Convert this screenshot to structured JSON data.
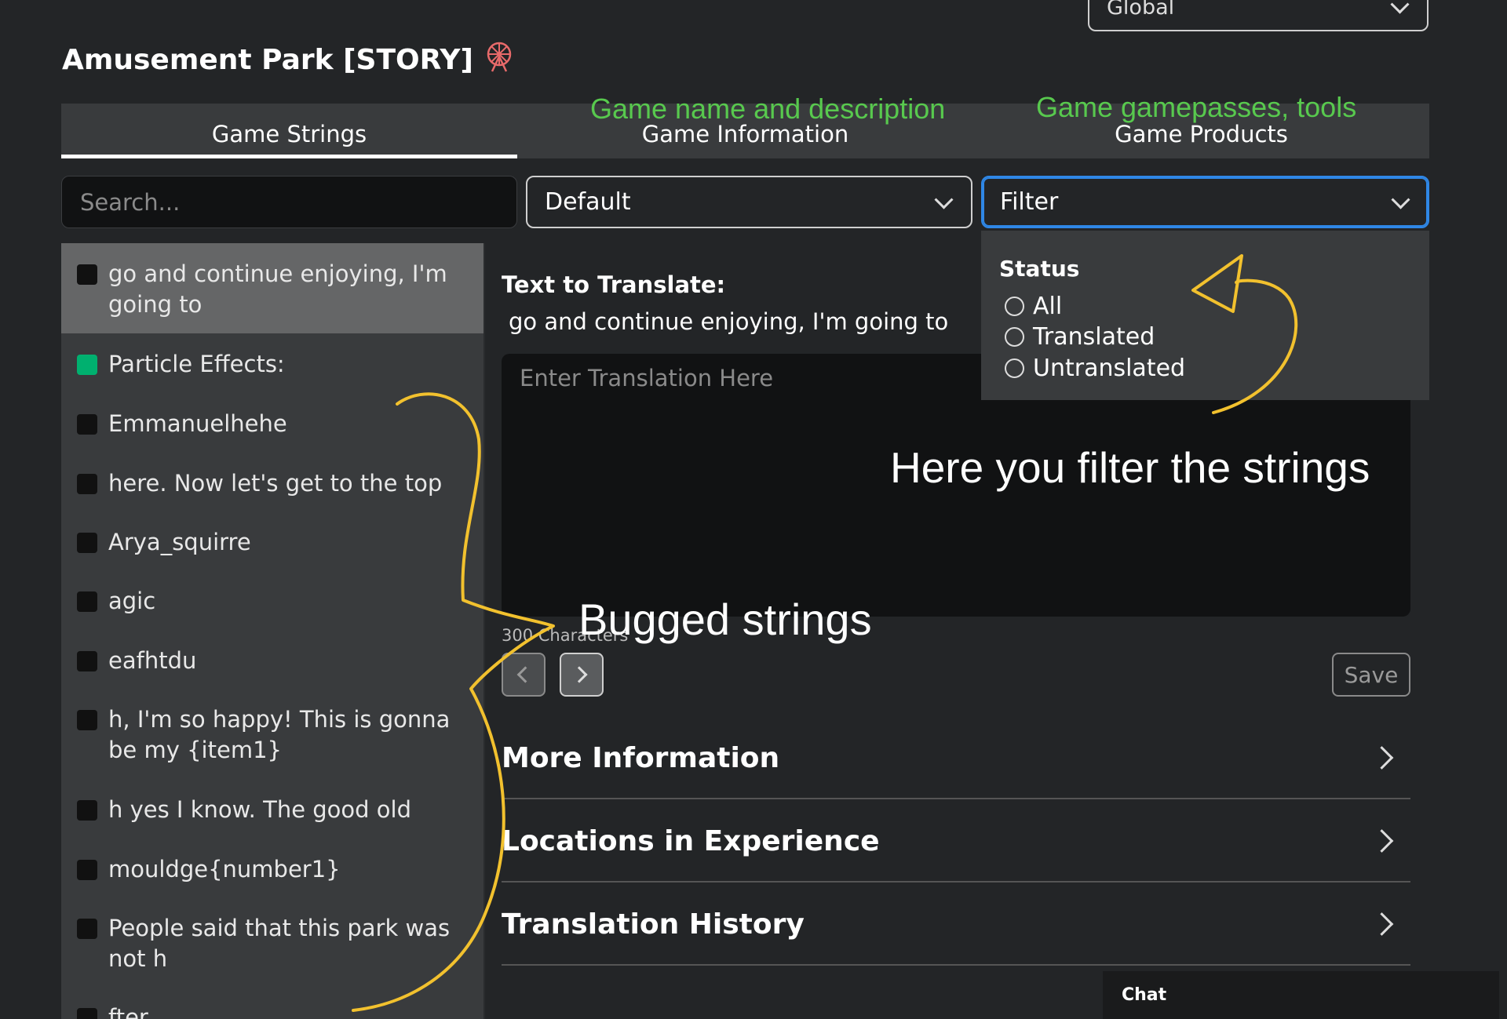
{
  "header": {
    "language_select": "Global",
    "game_title": "Amusement Park [STORY]",
    "title_icon": "ferris-wheel-icon"
  },
  "tabs": [
    {
      "label": "Game Strings",
      "active": true
    },
    {
      "label": "Game Information",
      "active": false
    },
    {
      "label": "Game Products",
      "active": false
    }
  ],
  "controls": {
    "search_placeholder": "Search...",
    "sort_select": "Default",
    "filter_select": "Filter"
  },
  "filter_popup": {
    "status_label": "Status",
    "options": [
      "All",
      "Translated",
      "Untranslated"
    ]
  },
  "strings_list": [
    {
      "text": "go and continue enjoying, I'm going to",
      "translated": false,
      "selected": true
    },
    {
      "text": "Particle Effects:",
      "translated": true,
      "selected": false
    },
    {
      "text": "Emmanuelhehe",
      "translated": false,
      "selected": false
    },
    {
      "text": "here. Now let's get to the top",
      "translated": false,
      "selected": false
    },
    {
      "text": "Arya_squirre",
      "translated": false,
      "selected": false
    },
    {
      "text": "agic",
      "translated": false,
      "selected": false
    },
    {
      "text": "eafhtdu",
      "translated": false,
      "selected": false
    },
    {
      "text": "h, I'm so happy! This is gonna be my {item1}",
      "translated": false,
      "selected": false
    },
    {
      "text": "h yes I know. The good old",
      "translated": false,
      "selected": false
    },
    {
      "text": "mouldge{number1}",
      "translated": false,
      "selected": false
    },
    {
      "text": "People said that this park was not h",
      "translated": false,
      "selected": false
    },
    {
      "text": "fter",
      "translated": false,
      "selected": false
    }
  ],
  "editor": {
    "text_to_translate_label": "Text to Translate:",
    "source_text": "go and continue enjoying, I'm going to",
    "translation_placeholder": "Enter Translation Here",
    "char_limit": "300 Characters",
    "save_label": "Save"
  },
  "sections": [
    "More Information",
    "Locations in Experience",
    "Translation History"
  ],
  "chat_label": "Chat",
  "annotations": {
    "game_info_note": "Game name and description",
    "game_products_note": "Game gamepasses, tools",
    "filter_note": "Here you filter the strings",
    "bugged_note": "Bugged strings"
  },
  "colors": {
    "background": "#232527",
    "panel": "#393b3d",
    "translated_green": "#00b06f",
    "filter_focus": "#2f87e6",
    "annotation_green": "#58c94e",
    "annotation_yellow": "#f2c12e"
  }
}
